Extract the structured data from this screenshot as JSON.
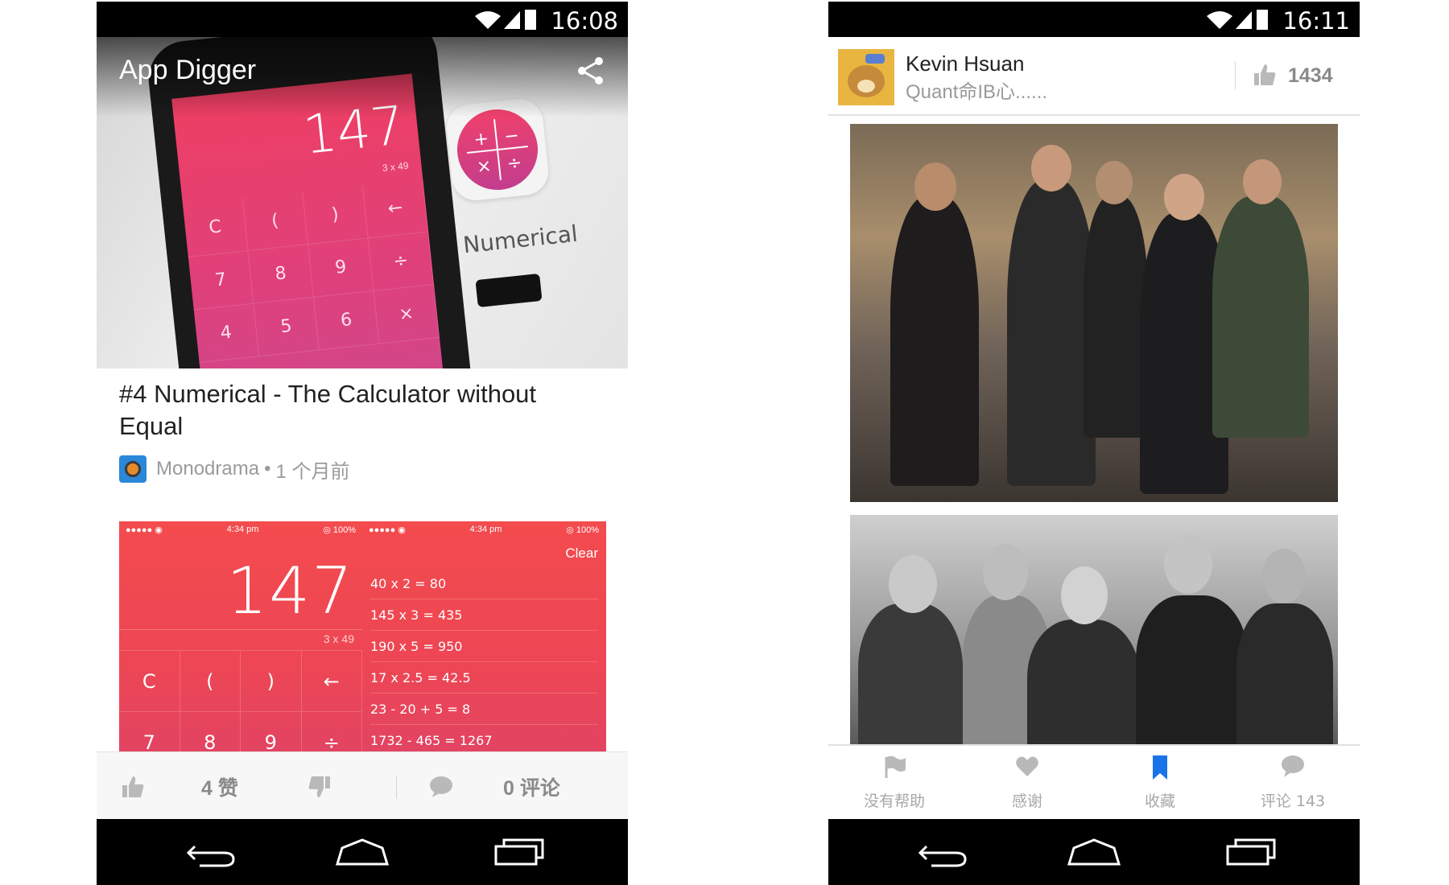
{
  "left_phone": {
    "status": {
      "time": "16:08"
    },
    "hero": {
      "app_title": "App Digger",
      "screen_number": "147",
      "screen_sub": "3 x 49",
      "keys": [
        "C",
        "(",
        ")",
        "←",
        "7",
        "8",
        "9",
        "÷",
        "4",
        "5",
        "6",
        "×"
      ],
      "app_name": "Numerical"
    },
    "post": {
      "title": "#4 Numerical - The Calculator without Equal",
      "source": "Monodrama",
      "separator": "•",
      "time": "1 个月前"
    },
    "screenshot": {
      "left_status": {
        "carrier": "●●●●● ◉",
        "time": "4:34 pm",
        "battery": "◎ 100%"
      },
      "right_status": {
        "carrier": "●●●●● ◉",
        "time": "4:34 pm",
        "battery": "◎ 100%"
      },
      "big_number": "147",
      "sub_expr": "3 x 49",
      "keys": [
        "C",
        "(",
        ")",
        "←",
        "7",
        "8",
        "9",
        "÷"
      ],
      "clear_label": "Clear",
      "history": [
        "40 x 2 = 80",
        "145 x 3 = 435",
        "190 x 5 = 950",
        "17 x 2.5 = 42.5",
        "23 - 20 + 5 = 8",
        "1732 - 465 = 1267"
      ]
    },
    "actions": {
      "likes": "4 赞",
      "comments": "0 评论"
    }
  },
  "right_phone": {
    "status": {
      "time": "16:11"
    },
    "user": {
      "name": "Kevin Hsuan",
      "bio": "Quant命IB心......",
      "likes": "1434"
    },
    "tabs": [
      {
        "label": "没有帮助",
        "icon": "flag-icon"
      },
      {
        "label": "感谢",
        "icon": "heart-icon"
      },
      {
        "label": "收藏",
        "icon": "bookmark-icon"
      },
      {
        "label": "评论 143",
        "icon": "comment-icon"
      }
    ]
  },
  "colors": {
    "accent_blue": "#1a73e8",
    "calc_red": "#ee4654",
    "icon_gray": "#b9b9b9",
    "text_gray": "#8a8a8a"
  }
}
